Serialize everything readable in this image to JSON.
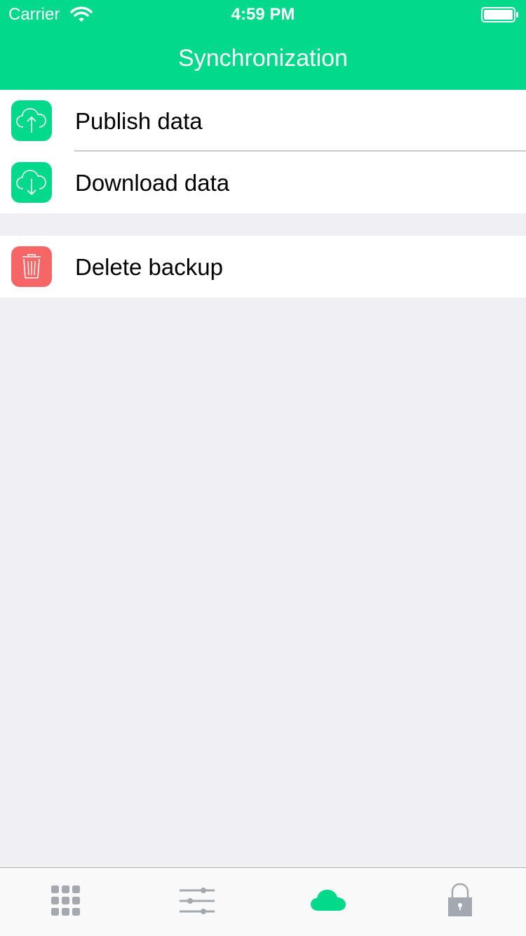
{
  "status_bar": {
    "carrier": "Carrier",
    "time": "4:59 PM"
  },
  "nav": {
    "title": "Synchronization"
  },
  "list": {
    "group1": [
      {
        "label": "Publish data",
        "icon": "cloud-upload-icon",
        "color": "#02d98b"
      },
      {
        "label": "Download data",
        "icon": "cloud-download-icon",
        "color": "#02d98b"
      }
    ],
    "group2": [
      {
        "label": "Delete backup",
        "icon": "trash-icon",
        "color": "#f66666"
      }
    ]
  },
  "tab_bar": {
    "tabs": [
      {
        "icon": "grid-icon",
        "active": false
      },
      {
        "icon": "sliders-icon",
        "active": false
      },
      {
        "icon": "cloud-icon",
        "active": true
      },
      {
        "icon": "lock-icon",
        "active": false
      }
    ],
    "active_color": "#02d98b",
    "inactive_color": "#a4a9b1"
  },
  "colors": {
    "brand": "#02d98b",
    "danger": "#f66666",
    "background": "#efeff4"
  }
}
